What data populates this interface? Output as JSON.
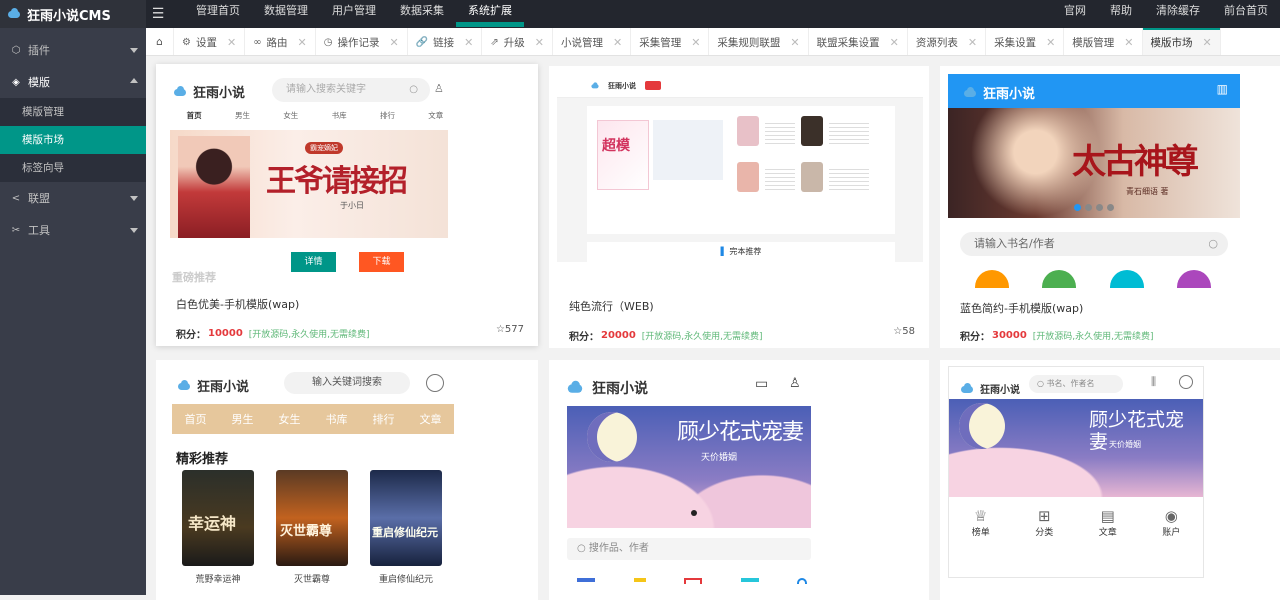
{
  "app": {
    "name": "狂雨小说CMS"
  },
  "topnav": [
    "管理首页",
    "数据管理",
    "用户管理",
    "数据采集",
    "系统扩展"
  ],
  "topnav_active": 4,
  "topright": [
    "官网",
    "帮助",
    "清除缓存",
    "前台首页"
  ],
  "sidebar": {
    "groups": [
      {
        "label": "插件",
        "icon": "puzzle-icon"
      },
      {
        "label": "模版",
        "icon": "layers-icon"
      },
      {
        "label": "联盟",
        "icon": "share-icon"
      },
      {
        "label": "工具",
        "icon": "tools-icon"
      }
    ],
    "sub_items": [
      "模版管理",
      "模版市场",
      "标签向导"
    ],
    "active_sub": 1
  },
  "tabs": [
    {
      "label": "设置",
      "icon": "gear-icon"
    },
    {
      "label": "路由",
      "icon": "link-icon"
    },
    {
      "label": "操作记录",
      "icon": "clock-icon"
    },
    {
      "label": "链接",
      "icon": "chain-icon"
    },
    {
      "label": "升级",
      "icon": "upgrade-icon"
    },
    {
      "label": "小说管理"
    },
    {
      "label": "采集管理"
    },
    {
      "label": "采集规则联盟"
    },
    {
      "label": "联盟采集设置"
    },
    {
      "label": "资源列表"
    },
    {
      "label": "采集设置"
    },
    {
      "label": "模版管理"
    },
    {
      "label": "模版市场"
    }
  ],
  "active_tab": 12,
  "cards": [
    {
      "title": "白色优美-手机模版(wap)",
      "points_label": "积分：",
      "points": "10000",
      "note": "[开放源码,永久使用,无需续费]",
      "stars": "☆577",
      "preview": {
        "brand": "狂雨小说",
        "search_placeholder": "请输入搜索关键字",
        "nav": [
          "首页",
          "男生",
          "女生",
          "书库",
          "排行",
          "文章"
        ],
        "banner_text": "王爷请接招",
        "banner_tag": "霸宠嫡妃",
        "banner_author": "于小日",
        "section": "重磅推荐",
        "btn_detail": "详情",
        "btn_download": "下载"
      }
    },
    {
      "title": "纯色流行（WEB)",
      "points_label": "积分：",
      "points": "20000",
      "note": "[开放源码,永久使用,无需续费]",
      "stars": "☆58",
      "preview": {
        "brand": "狂雨小说",
        "section": "完本推荐",
        "banner_text": "超模"
      }
    },
    {
      "title": "蓝色简约-手机模版(wap)",
      "points_label": "积分：",
      "points": "30000",
      "note": "[开放源码,永久使用,无需续费]",
      "stars": "",
      "preview": {
        "brand": "狂雨小说",
        "banner_text": "太古神尊",
        "banner_author": "青石细语 著",
        "search_placeholder": "请输入书名/作者"
      }
    },
    {
      "title": "",
      "preview": {
        "brand": "狂雨小说",
        "search_placeholder": "输入关键词搜索",
        "nav": [
          "首页",
          "男生",
          "女生",
          "书库",
          "排行",
          "文章"
        ],
        "section": "精彩推荐",
        "books": [
          "荒野幸运神",
          "灭世霸尊",
          "重启修仙纪元"
        ],
        "covers": [
          "幸运神",
          "灭世霸尊",
          "重启修仙纪元"
        ]
      }
    },
    {
      "title": "",
      "preview": {
        "brand": "狂雨小说",
        "banner_text": "顾少花式宠妻",
        "banner_sub": "天价婚姻",
        "search_placeholder": "搜作品、作者"
      }
    },
    {
      "title": "",
      "preview": {
        "brand": "狂雨小说",
        "search_placeholder": "书名、作者名",
        "banner_text": "顾少花式宠妻",
        "banner_sub": "天价婚姻",
        "icons": [
          "榜单",
          "分类",
          "文章",
          "账户"
        ]
      }
    }
  ],
  "colors": {
    "accent": "#009688",
    "sidebar": "#393d49",
    "topbar": "#23262e",
    "points": "#e4393c",
    "note": "#5fb878"
  }
}
